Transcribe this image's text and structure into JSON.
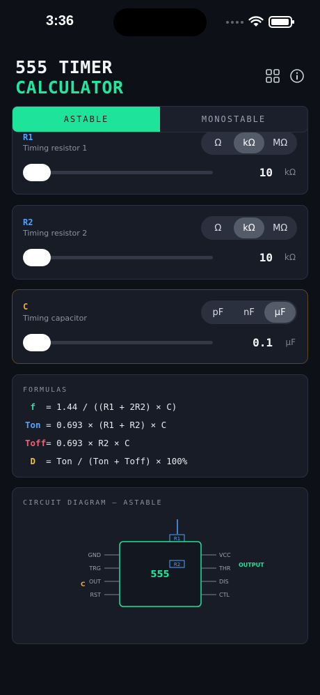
{
  "status_bar": {
    "time": "3:36"
  },
  "header": {
    "title_line1": "555 TIMER",
    "title_line2": "CALCULATOR",
    "icons": [
      "grid-icon",
      "info-icon"
    ]
  },
  "mode_tabs": [
    {
      "label": "ASTABLE",
      "active": true
    },
    {
      "label": "MONOSTABLE",
      "active": false
    }
  ],
  "components": {
    "r1": {
      "name": "R1",
      "desc": "Timing resistor 1",
      "units": [
        "Ω",
        "kΩ",
        "MΩ"
      ],
      "selected_unit": "kΩ",
      "value": "10",
      "unit_label": "kΩ",
      "slider_fraction": 0.0,
      "name_color": "#4fa3ff"
    },
    "r2": {
      "name": "R2",
      "desc": "Timing resistor 2",
      "units": [
        "Ω",
        "kΩ",
        "MΩ"
      ],
      "selected_unit": "kΩ",
      "value": "10",
      "unit_label": "kΩ",
      "slider_fraction": 0.0,
      "name_color": "#4fa3ff"
    },
    "c": {
      "name": "C",
      "desc": "Timing capacitor",
      "units": [
        "pF",
        "nF",
        "µF"
      ],
      "selected_unit": "µF",
      "value": "0.1",
      "unit_label": "µF",
      "slider_fraction": 0.0,
      "name_color": "#f0a83a"
    }
  },
  "formulas": {
    "label": "FORMULAS",
    "rows": [
      {
        "symbol": " f  ",
        "expr": "= 1.44 / ((R1 + 2R2) × C)",
        "color": "#22e6a0"
      },
      {
        "symbol": "Ton ",
        "expr": "= 0.693 × (R1 + R2) × C",
        "color": "#4fa3ff"
      },
      {
        "symbol": "Toff",
        "expr": "= 0.693 × R2 × C",
        "color": "#ff5a6e"
      },
      {
        "symbol": " D  ",
        "expr": "= Ton / (Ton + Toff) × 100%",
        "color": "#f0c040"
      }
    ]
  },
  "circuit": {
    "label": "CIRCUIT DIAGRAM — ASTABLE",
    "chip_label": "555",
    "left_pins": [
      "GND",
      "TRG",
      "OUT",
      "RST"
    ],
    "right_pins": [
      "VCC",
      "THR",
      "DIS",
      "CTL"
    ],
    "r1_label": "R1",
    "r2_label": "R2",
    "c_label": "C",
    "output_label": "OUTPUT"
  },
  "colors": {
    "accent": "#1ee39a",
    "resistor": "#4fa3ff",
    "capacitor": "#f0a83a",
    "background": "#0d1017"
  }
}
